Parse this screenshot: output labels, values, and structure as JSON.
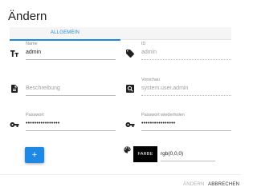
{
  "dialog": {
    "title": "Ändern"
  },
  "tabs": [
    {
      "label": "ALLGEMEIN"
    }
  ],
  "fields": {
    "name": {
      "label": "Name",
      "value": "admin"
    },
    "id": {
      "label": "ID",
      "value": "admin"
    },
    "description": {
      "placeholder": "Beschreibung"
    },
    "prefix": {
      "label": "Vorschau",
      "value": "system.user.admin"
    },
    "password": {
      "label": "Passwort",
      "value": "••••••••••••••••"
    },
    "password_repeat": {
      "label": "Passwort wiederholen",
      "value": "••••••••••••••••"
    }
  },
  "color": {
    "button_label": "FARBE",
    "value": "rgb(0,0,0)",
    "swatch": "#000000"
  },
  "add_button": {
    "label": "+"
  },
  "footer": {
    "save_label": "ÄNDERN",
    "cancel_label": "ABBRECHEN"
  },
  "colors": {
    "accent": "#1e88e5"
  }
}
